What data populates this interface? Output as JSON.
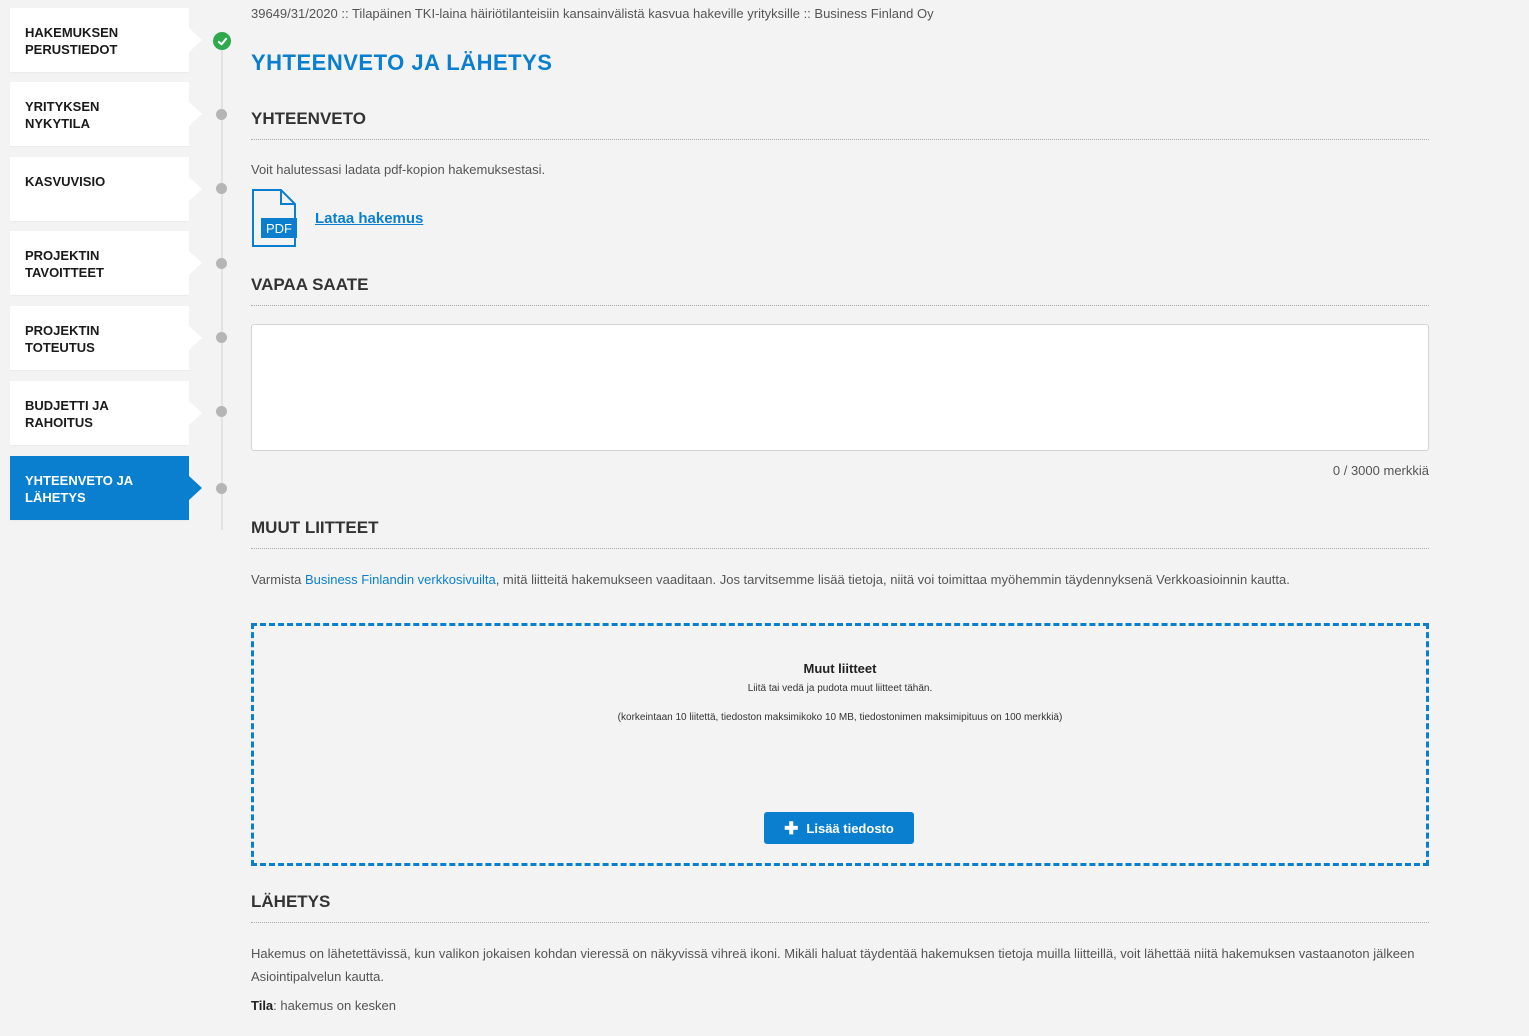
{
  "sidebar": {
    "items": [
      {
        "line1": "HAKEMUKSEN",
        "line2": "PERUSTIEDOT",
        "status": "complete"
      },
      {
        "line1": "YRITYKSEN",
        "line2": "NYKYTILA",
        "status": "pending"
      },
      {
        "line1": "KASVUVISIO",
        "line2": "",
        "status": "pending"
      },
      {
        "line1": "PROJEKTIN",
        "line2": "TAVOITTEET",
        "status": "pending"
      },
      {
        "line1": "PROJEKTIN",
        "line2": "TOTEUTUS",
        "status": "pending"
      },
      {
        "line1": "BUDJETTI JA",
        "line2": "RAHOITUS",
        "status": "pending"
      },
      {
        "line1": "YHTEENVETO JA",
        "line2": "LÄHETYS",
        "status": "active"
      }
    ]
  },
  "breadcrumb": "39649/31/2020 :: Tilapäinen TKI-laina häiriötilanteisiin kansainvälistä kasvua hakeville yrityksille :: Business Finland Oy",
  "page_title": "YHTEENVETO JA LÄHETYS",
  "summary": {
    "heading": "YHTEENVETO",
    "text": "Voit halutessasi ladata pdf-kopion hakemuksestasi.",
    "pdf_badge": "PDF",
    "download_label": "Lataa hakemus"
  },
  "cover_letter": {
    "heading": "VAPAA SAATE",
    "value": "",
    "counter": "0 / 3000 merkkiä"
  },
  "attachments": {
    "heading": "MUUT LIITTEET",
    "text_before": "Varmista ",
    "link_text": "Business Finlandin verkkosivuilta",
    "text_after": ", mitä liitteitä hakemukseen vaaditaan. Jos tarvitsemme lisää tietoja, niitä voi toimittaa myöhemmin täydennyksenä Verkkoasioinnin kautta.",
    "dropzone_title": "Muut liitteet",
    "dropzone_sub": "Liitä tai vedä ja pudota muut liitteet tähän.",
    "dropzone_limits": "(korkeintaan 10 liitettä, tiedoston maksimikoko 10 MB, tiedostonimen maksimipituus on 100 merkkiä)",
    "add_button": "Lisää tiedosto"
  },
  "sending": {
    "heading": "LÄHETYS",
    "text": "Hakemus on lähetettävissä, kun valikon jokaisen kohdan vieressä on näkyvissä vihreä ikoni. Mikäli haluat täydentää hakemuksen tietoja muilla liitteillä, voit lähettää niitä hakemuksen vastaanoton jälkeen Asiointipalvelun kautta.",
    "status_label": "Tila",
    "status_value": ": hakemus on kesken"
  },
  "colors": {
    "accent": "#0a7fcf",
    "complete": "#2fa94e",
    "pending_dot": "#b5b5b5"
  }
}
